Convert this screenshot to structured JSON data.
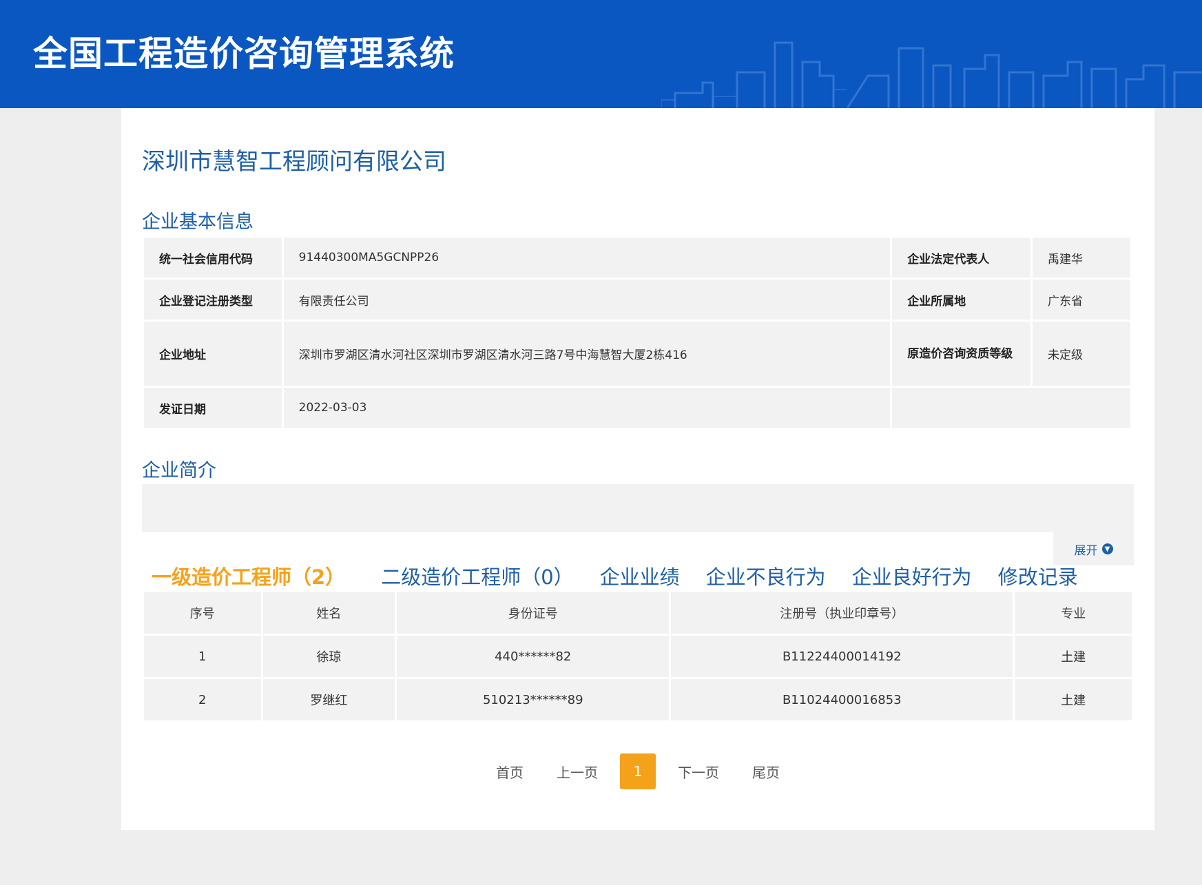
{
  "header": {
    "title": "全国工程造价咨询管理系统"
  },
  "company": {
    "name": "深圳市慧智工程顾问有限公司"
  },
  "basic_info": {
    "section_title": "企业基本信息",
    "credit_code_label": "统一社会信用代码",
    "credit_code": "91440300MA5GCNPP26",
    "legal_rep_label": "企业法定代表人",
    "legal_rep": "禹建华",
    "reg_type_label": "企业登记注册类型",
    "reg_type": "有限责任公司",
    "location_label": "企业所属地",
    "location": "广东省",
    "address_label": "企业地址",
    "address": "深圳市罗湖区清水河社区深圳市罗湖区清水河三路7号中海慧智大厦2栋416",
    "grade_label": "原造价咨询资质等级",
    "grade": "未定级",
    "issue_date_label": "发证日期",
    "issue_date": "2022-03-03"
  },
  "intro": {
    "section_title": "企业简介",
    "expand_label": "展开"
  },
  "tabs": [
    {
      "label": "一级造价工程师（2）",
      "active": true
    },
    {
      "label": "二级造价工程师（0）"
    },
    {
      "label": "企业业绩"
    },
    {
      "label": "企业不良行为"
    },
    {
      "label": "企业良好行为"
    },
    {
      "label": "修改记录"
    }
  ],
  "table": {
    "headers": [
      "序号",
      "姓名",
      "身份证号",
      "注册号（执业印章号）",
      "专业"
    ],
    "rows": [
      [
        "1",
        "徐琼",
        "440******82",
        "B11224400014192",
        "土建"
      ],
      [
        "2",
        "罗继红",
        "510213******89",
        "B11024400016853",
        "土建"
      ]
    ]
  },
  "pager": {
    "first": "首页",
    "prev": "上一页",
    "current": "1",
    "next": "下一页",
    "last": "尾页"
  },
  "colors": {
    "header_bg": "#0a57c2",
    "accent": "#f5a21b",
    "link": "#1f5fa5"
  }
}
